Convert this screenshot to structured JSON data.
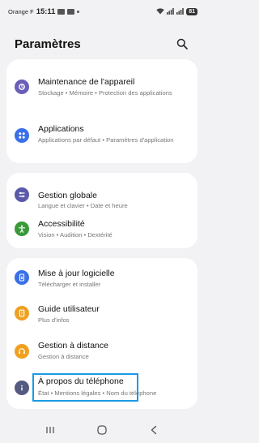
{
  "status_bar": {
    "carrier": "Orange F",
    "time": "15:11",
    "battery": "81"
  },
  "header": {
    "title": "Paramètres",
    "search_icon": "search-icon"
  },
  "cards": [
    {
      "items": [
        {
          "title": "Maintenance de l'appareil",
          "subtitle": "Stockage • Mémoire • Protection des applications",
          "icon": "device-care-icon",
          "color": "#6a5fb8"
        },
        {
          "title": "Applications",
          "subtitle": "Applications par défaut • Paramètres d'application",
          "icon": "apps-icon",
          "color": "#3a6fe8"
        }
      ]
    },
    {
      "items": [
        {
          "title": "Gestion globale",
          "subtitle": "Langue et clavier • Date et heure",
          "icon": "sliders-icon",
          "color": "#5a5aa8"
        },
        {
          "title": "Accessibilité",
          "subtitle": "Vision • Audition • Dextérité",
          "icon": "accessibility-icon",
          "color": "#3a9a3a"
        }
      ]
    },
    {
      "items": [
        {
          "title": "Mise à jour logicielle",
          "subtitle": "Télécharger et installer",
          "icon": "software-update-icon",
          "color": "#3a6fe8"
        },
        {
          "title": "Guide utilisateur",
          "subtitle": "Plus d'infos",
          "icon": "user-guide-icon",
          "color": "#f0a020"
        },
        {
          "title": "Gestion à distance",
          "subtitle": "Gestion à distance",
          "icon": "headset-icon",
          "color": "#f0a020"
        },
        {
          "title": "À propos du téléphone",
          "subtitle": "État • Mentions légales • Nom du téléphone",
          "icon": "info-icon",
          "color": "#555a80"
        }
      ]
    }
  ],
  "nav_bar": {
    "recents_icon": "recents-icon",
    "home_icon": "home-icon",
    "back_icon": "back-icon"
  },
  "highlight_color": "#1a9be6"
}
